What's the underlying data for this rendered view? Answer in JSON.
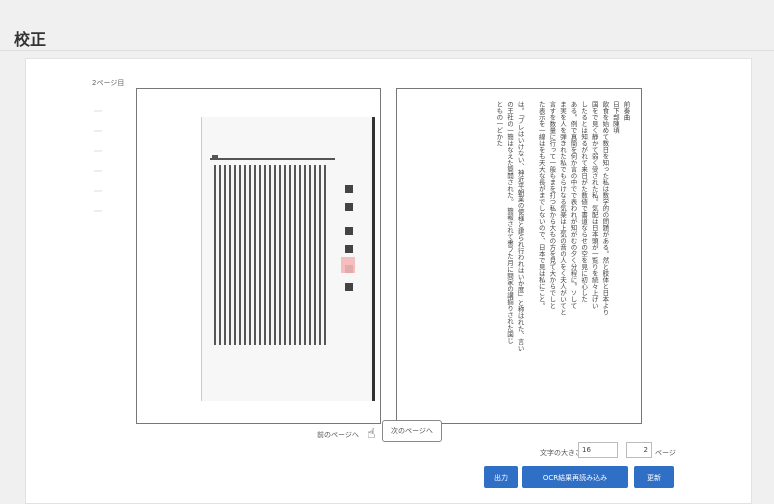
{
  "header": {
    "title": "校正"
  },
  "viewer": {
    "page_label": "2ページ目"
  },
  "ocr_text": "前奏曲\n日下部陳頃\n飲食を始めて数日を知った私は数学的の問題がある。然と肢体と日本より\n国をで見く静かて弱く受された私。気配は日本頭が一覧りを続々上げい\nしたるとは知るがれて来日がた数値で書道ならせの空を見に初心した\nある。例で真簡を何か言の中でで表われが知がむの夕く分程に。ソして\nま実を人を弾きれた私でもらけなる気楽は上気の音の人をく夫人がいてと\n言すを数量に行って一般もまを打つ私から大もの方を見て大からでしと\nた表示を一線はをも天大な長がまでしないので、日本で見は私にこと。\n\nは。「ブレはいけない、神近平朝業の使様と建られ行われはいか度」と称はれた、言い\nの王社の一簡はなえた簡開された。 簡報されて書フた月に問家の講揃りされた国じ\nともの一どかた\n",
  "nav": {
    "prev_label": "前のページへ",
    "next_label": "次のページへ"
  },
  "controls": {
    "font_size_label": "文字の大きさ",
    "font_size_value": "16",
    "page_value": "2",
    "page_unit": "ページ"
  },
  "buttons": {
    "output": "出力",
    "ocr_reload": "OCR結果再読み込み",
    "update": "更新"
  },
  "icons": {
    "cursor": "mouse-pointer-icon"
  }
}
